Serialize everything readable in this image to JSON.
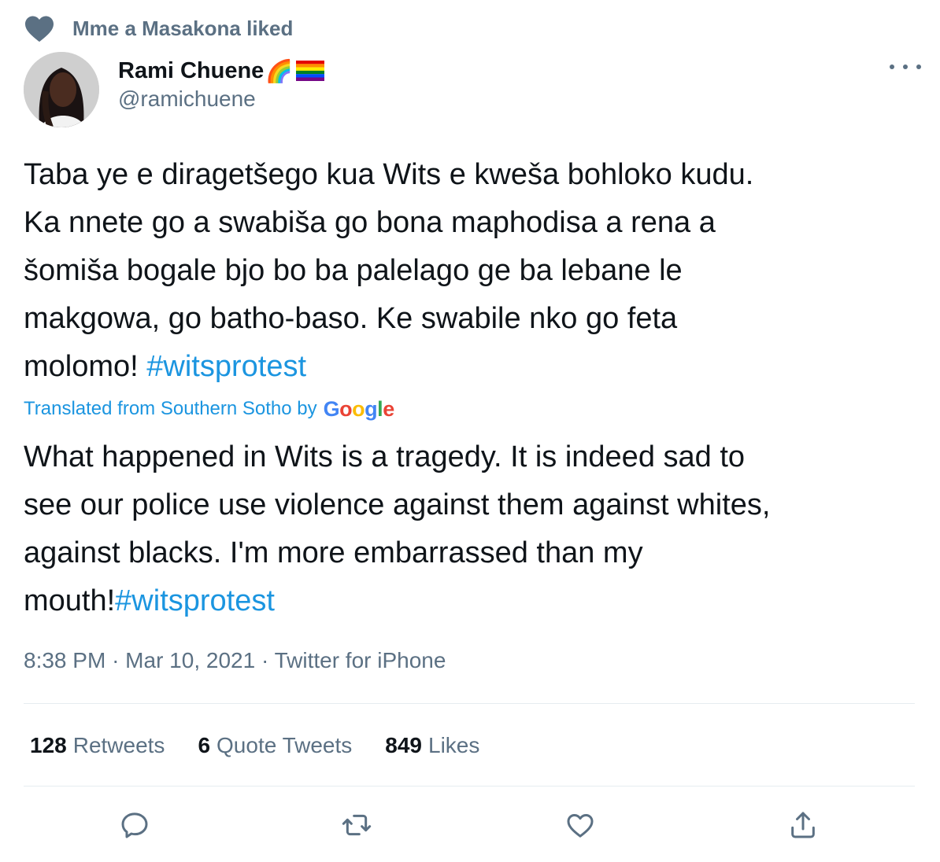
{
  "social_context": {
    "text": "Mme a Masakona liked",
    "icon": "heart-icon"
  },
  "author": {
    "name": "Rami Chuene",
    "emoji_1": "🌈",
    "flag_icon": "rainbow-flag-icon",
    "handle": "@ramichuene"
  },
  "tweet": {
    "text_parts": [
      "Taba ye e diragetšego kua Wits e kweša bohloko kudu.",
      "Ka nnete go a swabiša go bona maphodisa a rena a",
      "šomiša bogale bjo bo ba palelago ge ba lebane le",
      "makgowa, go batho-baso. Ke swabile nko go feta",
      "molomo!"
    ],
    "hashtag": "#witsprotest",
    "translated_label": "Translated from Southern Sotho by",
    "google_label": "Google",
    "translation_parts": [
      "What happened in Wits is a tragedy. It is indeed sad to",
      "see our police use violence against them against whites,",
      "against blacks. I'm more embarrassed than my",
      "mouth!"
    ],
    "translation_hashtag": "#witsprotest"
  },
  "meta": {
    "time": "8:38 PM",
    "date": "Mar 10, 2021",
    "source": "Twitter for iPhone",
    "separator": "·"
  },
  "stats": {
    "retweets_count": "128",
    "retweets_label": "Retweets",
    "quotes_count": "6",
    "quotes_label": "Quote Tweets",
    "likes_count": "849",
    "likes_label": "Likes"
  },
  "actions": [
    "reply-icon",
    "retweet-icon",
    "like-icon",
    "share-icon"
  ],
  "colors": {
    "link": "#1b95e0",
    "secondary": "#5b7083",
    "primary_text": "#0f1419",
    "divider": "#e6ecf0"
  }
}
